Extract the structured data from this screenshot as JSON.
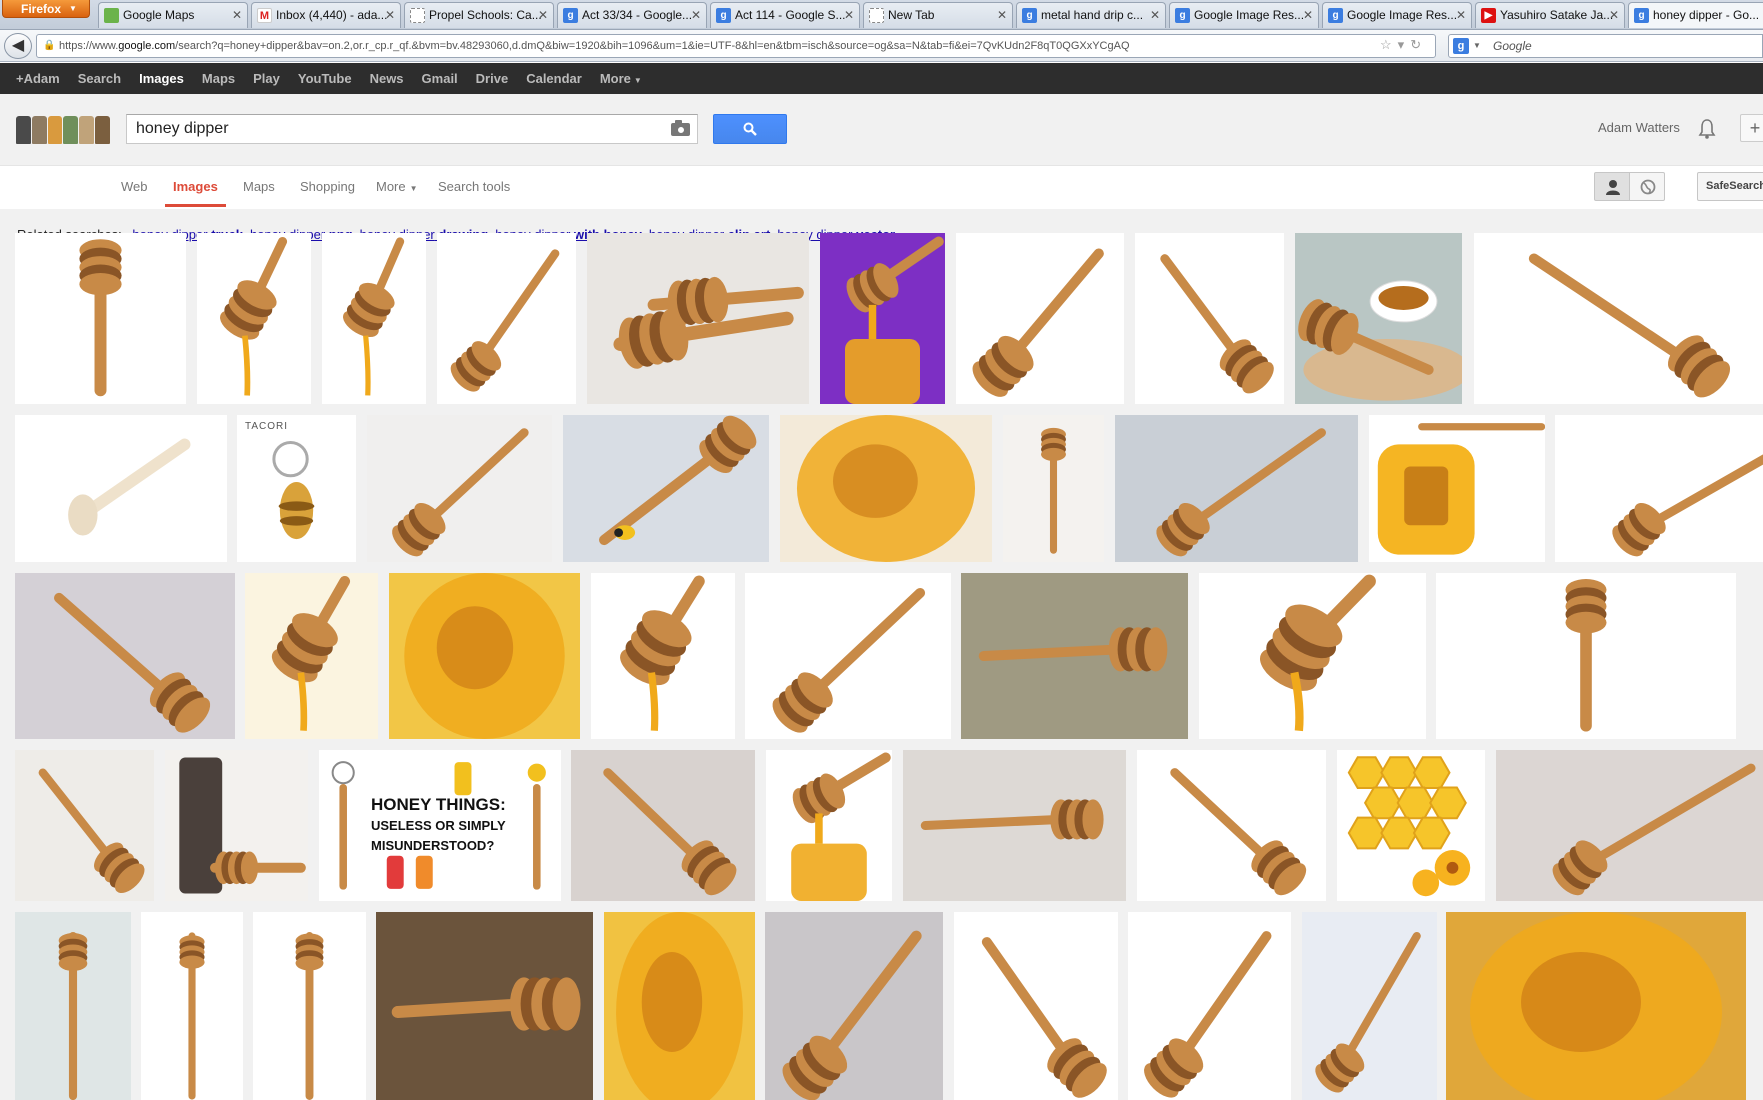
{
  "browser": {
    "menu_label": "Firefox",
    "tabs": [
      {
        "title": "Google Maps",
        "favicon": "maps"
      },
      {
        "title": "Inbox (4,440) - ada...",
        "favicon": "gmail"
      },
      {
        "title": "Propel Schools: Ca...",
        "favicon": "blank"
      },
      {
        "title": "Act 33/34 - Google...",
        "favicon": "google"
      },
      {
        "title": "Act 114 - Google S...",
        "favicon": "google"
      },
      {
        "title": "New Tab",
        "favicon": "blank"
      },
      {
        "title": "metal hand drip c...",
        "favicon": "google"
      },
      {
        "title": "Google Image Res...",
        "favicon": "google"
      },
      {
        "title": "Google Image Res...",
        "favicon": "google"
      },
      {
        "title": "Yasuhiro Satake Ja...",
        "favicon": "youtube"
      },
      {
        "title": "honey dipper - Go...",
        "favicon": "google",
        "active": true
      }
    ],
    "url_prefix": "https://www.",
    "url_host": "google.com",
    "url_rest": "/search?q=honey+dipper&bav=on.2,or.r_cp.r_qf.&bvm=bv.48293060,d.dmQ&biw=1920&bih=1096&um=1&ie=UTF-8&hl=en&tbm=isch&source=og&sa=N&tab=fi&ei=7QvKUdn2F8qT0QGXxYCgAQ",
    "search_placeholder": "Google"
  },
  "gbar": {
    "items": [
      "+Adam",
      "Search",
      "Images",
      "Maps",
      "Play",
      "YouTube",
      "News",
      "Gmail",
      "Drive",
      "Calendar",
      "More"
    ],
    "active": "Images"
  },
  "header": {
    "query": "honey dipper",
    "user_name": "Adam Watters",
    "share_symbol": "+"
  },
  "search_nav": {
    "tabs": [
      "Web",
      "Images",
      "Maps",
      "Shopping",
      "More",
      "Search tools"
    ],
    "active": "Images",
    "safesearch_label": "SafeSearch"
  },
  "related": {
    "prefix": "Related searches:",
    "items": [
      {
        "base": "honey dipper",
        "bold": "truck"
      },
      {
        "base": "honey dipper",
        "bold": "png"
      },
      {
        "base": "honey dipper",
        "bold": "drawing"
      },
      {
        "base": "honey dipper",
        "bold": "with honey"
      },
      {
        "base": "honey dipper",
        "bold": "clip art"
      },
      {
        "base": "honey dipper",
        "bold": "vector"
      }
    ]
  },
  "image_rows": [
    [
      {
        "bg": "#ffffff",
        "motif": "dipper-vertical"
      },
      {
        "bg": "#ffffff",
        "motif": "dipper-honey-drip"
      },
      {
        "bg": "#ffffff",
        "motif": "dipper-honey-drip"
      },
      {
        "bg": "#ffffff",
        "motif": "dipper-diagonal"
      },
      {
        "bg": "#e9e6e2",
        "motif": "two-dippers"
      },
      {
        "bg": "#7d2fc4",
        "motif": "dipper-jar"
      },
      {
        "bg": "#ffffff",
        "motif": "dipper-diagonal"
      },
      {
        "bg": "#ffffff",
        "motif": "dipper-diagonal-down"
      },
      {
        "bg": "#b9c6c4",
        "motif": "dipper-bowl"
      },
      {
        "bg": "#ffffff",
        "motif": "dipper-diagonal-down"
      }
    ],
    [
      {
        "bg": "#ffffff",
        "motif": "dipper-light"
      },
      {
        "bg": "#ffffff",
        "motif": "jewelry-bee",
        "caption": "TACORI"
      },
      {
        "bg": "#f0efee",
        "motif": "dipper-diagonal"
      },
      {
        "bg": "#d8dde4",
        "motif": "dipper-bee"
      },
      {
        "bg": "#f3ead9",
        "motif": "honey-closeup"
      },
      {
        "bg": "#f4f2ef",
        "motif": "dipper-vertical"
      },
      {
        "bg": "#c9cfd6",
        "motif": "dipper-diagonal"
      },
      {
        "bg": "#ffffff",
        "motif": "honey-pot"
      },
      {
        "bg": "#ffffff",
        "motif": "dipper-diagonal"
      }
    ],
    [
      {
        "bg": "#d4d0d6",
        "motif": "dipper-diagonal-down"
      },
      {
        "bg": "#fbf4e0",
        "motif": "dipper-honey-drip"
      },
      {
        "bg": "#f2c646",
        "motif": "honey-closeup"
      },
      {
        "bg": "#ffffff",
        "motif": "dipper-honey-drip"
      },
      {
        "bg": "#ffffff",
        "motif": "dipper-diagonal"
      },
      {
        "bg": "#9f9a82",
        "motif": "dipper-horizontal"
      },
      {
        "bg": "#ffffff",
        "motif": "dipper-honey-drip"
      },
      {
        "bg": "#ffffff",
        "motif": "dipper-vertical"
      }
    ],
    [
      {
        "bg": "#eeece8",
        "motif": "dipper-diagonal-down"
      },
      {
        "bg": "#f3f1ee",
        "motif": "bottle-dipper"
      },
      {
        "bg": "#ffffff",
        "motif": "honey-things",
        "caption_lines": [
          "HONEY THINGS:",
          "USELESS OR SIMPLY",
          "MISUNDERSTOOD?"
        ]
      },
      {
        "bg": "#d8d2cf",
        "motif": "dipper-diagonal-down"
      },
      {
        "bg": "#ffffff",
        "motif": "dipper-jar"
      },
      {
        "bg": "#ddd9d5",
        "motif": "dipper-horizontal"
      },
      {
        "bg": "#ffffff",
        "motif": "dipper-diagonal-down"
      },
      {
        "bg": "#ffffff",
        "motif": "honeycomb-flowers"
      },
      {
        "bg": "#dcd6d3",
        "motif": "dipper-diagonal"
      }
    ],
    [
      {
        "bg": "#dfe6e6",
        "motif": "dipper-vertical"
      },
      {
        "bg": "#ffffff",
        "motif": "dipper-vertical"
      },
      {
        "bg": "#ffffff",
        "motif": "dipper-vertical"
      },
      {
        "bg": "#6b543c",
        "motif": "dipper-horizontal"
      },
      {
        "bg": "#f1c241",
        "motif": "honey-closeup"
      },
      {
        "bg": "#c9c6c9",
        "motif": "dipper-diagonal"
      },
      {
        "bg": "#ffffff",
        "motif": "dipper-diagonal-down"
      },
      {
        "bg": "#ffffff",
        "motif": "dipper-diagonal"
      },
      {
        "bg": "#e8ecf3",
        "motif": "dipper-diagonal"
      },
      {
        "bg": "#e0a73a",
        "motif": "honey-closeup"
      }
    ]
  ]
}
